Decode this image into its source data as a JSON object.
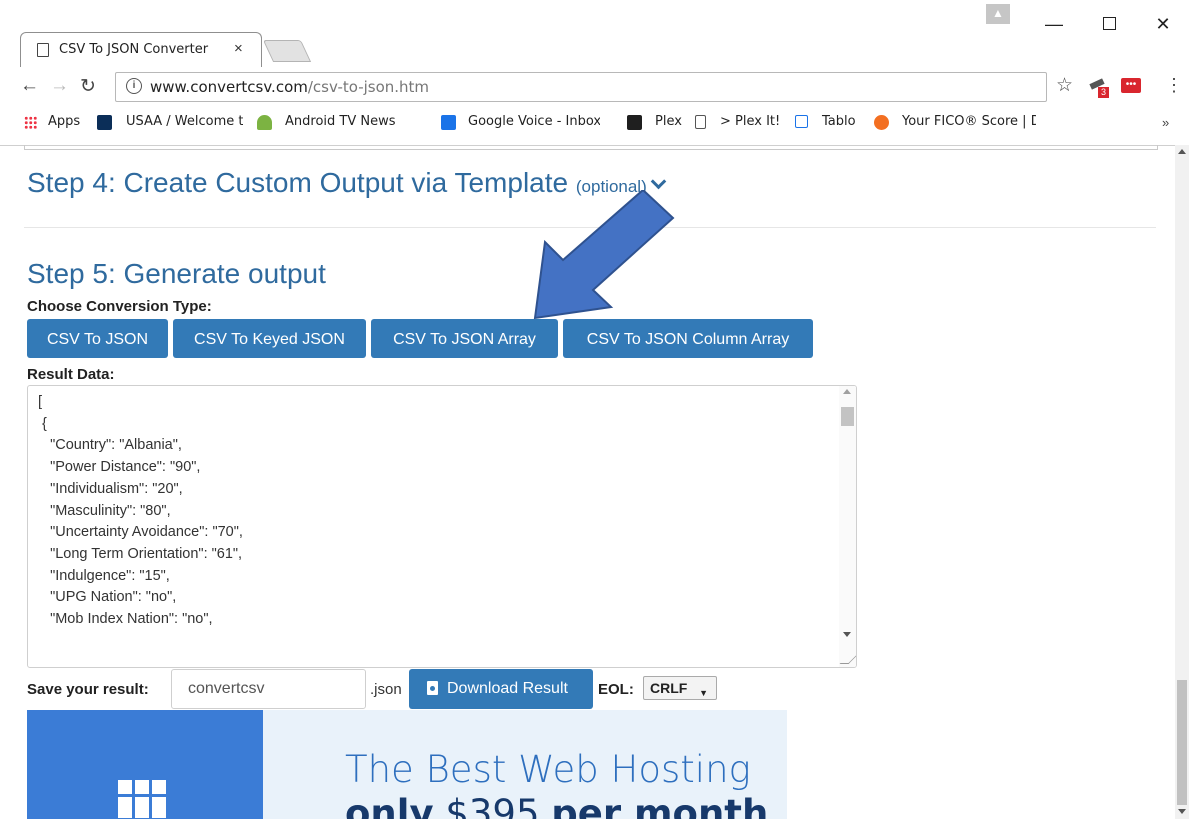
{
  "browser": {
    "tab_title": "CSV To JSON Converter",
    "tab_close": "×",
    "url_host": "www.convertcsv.com",
    "url_path": "/csv-to-json.htm",
    "ext_badge": "3",
    "ext2_label": "•••"
  },
  "bookmarks": [
    "Apps",
    "USAA / Welcome to U",
    "Android TV News",
    "Google Voice - Inbox",
    "Plex",
    "> Plex It!",
    "Tablo",
    "Your FICO® Score | D"
  ],
  "bookmarks_more": "»",
  "page": {
    "step4_title": "Step 4: Create Custom Output via Template",
    "step4_optional": "(optional)",
    "step5_title": "Step 5: Generate output",
    "conversion_label": "Choose Conversion Type:",
    "buttons": {
      "csv_to_json": "CSV To JSON",
      "csv_to_keyed_json": "CSV To Keyed JSON",
      "csv_to_json_array": "CSV To JSON Array",
      "csv_to_json_column_array": "CSV To JSON Column Array"
    },
    "result_label": "Result Data:",
    "result_text": "[\n {\n   \"Country\": \"Albania\",\n   \"Power Distance\": \"90\",\n   \"Individualism\": \"20\",\n   \"Masculinity\": \"80\",\n   \"Uncertainty Avoidance\": \"70\",\n   \"Long Term Orientation\": \"61\",\n   \"Indulgence\": \"15\",\n   \"UPG Nation\": \"no\",\n   \"Mob Index Nation\": \"no\",",
    "save_label": "Save your result:",
    "save_value": "convertcsv",
    "save_ext": ".json",
    "download_label": "Download Result",
    "eol_label": "EOL:",
    "eol_value": "CRLF"
  },
  "ad": {
    "headline": "The Best Web Hosting",
    "sub_prefix": "only",
    "sub_price": "$395",
    "sub_suffix": "per month"
  },
  "colors": {
    "accent": "#337ab7",
    "heading": "#2f6a9e",
    "arrow": "#4472c4"
  }
}
